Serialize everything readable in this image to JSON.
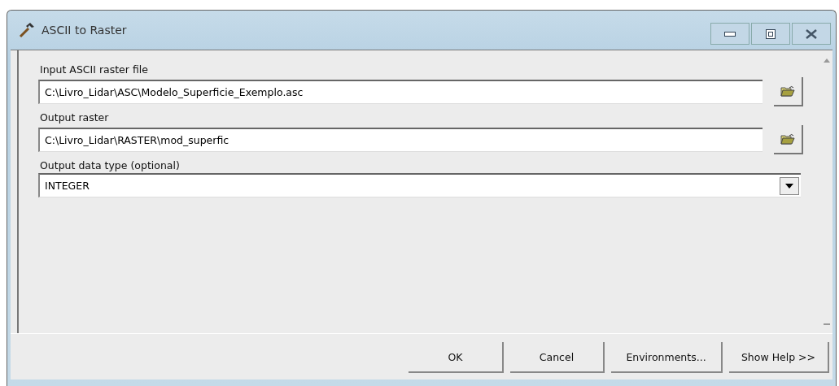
{
  "window": {
    "title": "ASCII to Raster"
  },
  "parameters": [
    {
      "kind": "file",
      "label": "Input ASCII raster file",
      "value": "C:\\Livro_Lidar\\ASC\\Modelo_Superficie_Exemplo.asc"
    },
    {
      "kind": "file",
      "label": "Output raster",
      "value": "C:\\Livro_Lidar\\RASTER\\mod_superfic"
    },
    {
      "kind": "dropdown",
      "label": "Output data type (optional)",
      "value": "INTEGER"
    }
  ],
  "buttons": [
    "OK",
    "Cancel",
    "Environments...",
    "Show Help >>"
  ]
}
